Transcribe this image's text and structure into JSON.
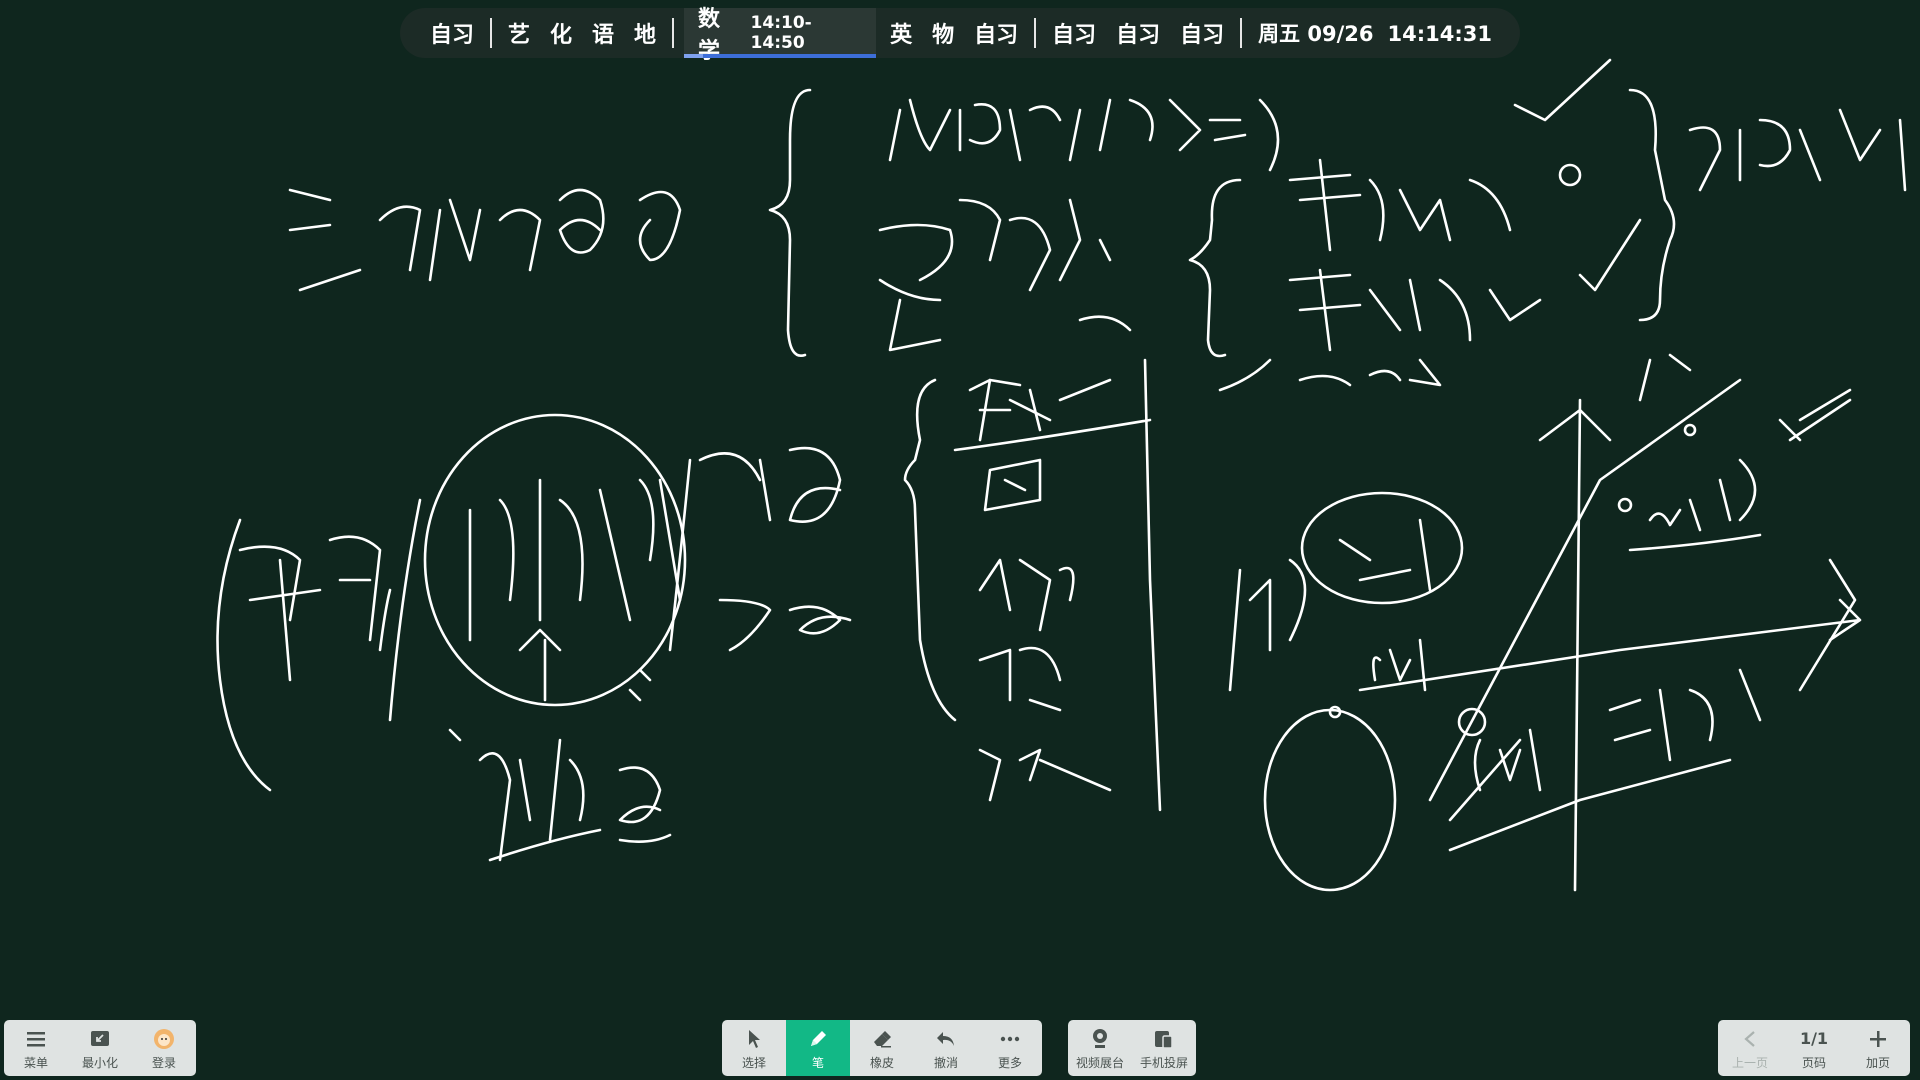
{
  "schedule": {
    "periods_a": [
      "自习"
    ],
    "periods_b": [
      "艺",
      "化",
      "语",
      "地"
    ],
    "current": {
      "subject": "数学",
      "time": "14:10-14:50",
      "progress": 0.1
    },
    "periods_c": [
      "英",
      "物",
      "自习"
    ],
    "periods_d": [
      "自习",
      "自习",
      "自习"
    ],
    "date": "周五 09/26",
    "clock": "14:14:31"
  },
  "toolbar_left": {
    "menu": {
      "icon": "menu-icon",
      "label": "菜单"
    },
    "minimize": {
      "icon": "minimize-icon",
      "label": "最小化"
    },
    "login": {
      "icon": "avatar-icon",
      "label": "登录"
    }
  },
  "toolbar_center": {
    "select": {
      "icon": "cursor-icon",
      "label": "选择"
    },
    "pen": {
      "icon": "pen-icon",
      "label": "笔",
      "active": true
    },
    "eraser": {
      "icon": "eraser-icon",
      "label": "橡皮"
    },
    "undo": {
      "icon": "undo-icon",
      "label": "撤消"
    },
    "more": {
      "icon": "more-icon",
      "label": "更多"
    }
  },
  "toolbar_media": {
    "video_booth": {
      "icon": "camera-icon",
      "label": "视频展台"
    },
    "phone_cast": {
      "icon": "phone-icon",
      "label": "手机投屏"
    }
  },
  "toolbar_pages": {
    "prev": {
      "icon": "chevron-left-icon",
      "label": "上一页"
    },
    "page": {
      "value": "1/1",
      "label": "页码"
    },
    "add": {
      "icon": "plus-icon",
      "label": "加页"
    }
  },
  "colors": {
    "board": "#0f261e",
    "ink": "#ffffff",
    "accent": "#12b886",
    "progress": "#3d6ed8"
  }
}
